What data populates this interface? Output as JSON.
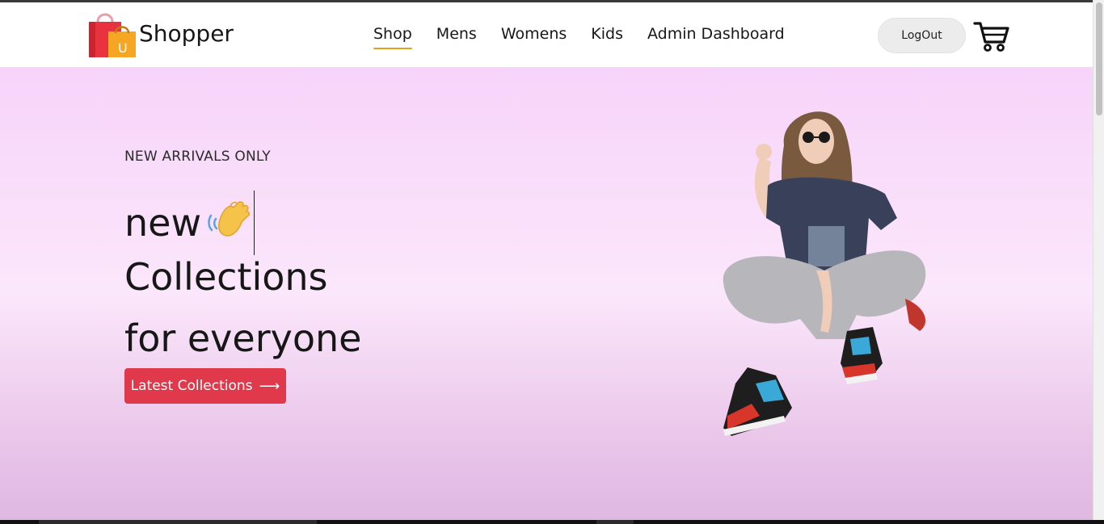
{
  "navbar": {
    "brand": "Shopper",
    "logo_letter": "U",
    "menu": [
      {
        "label": "Shop",
        "active": true
      },
      {
        "label": "Mens",
        "active": false
      },
      {
        "label": "Womens",
        "active": false
      },
      {
        "label": "Kids",
        "active": false
      },
      {
        "label": "Admin Dashboard",
        "active": false
      }
    ],
    "logout_label": "LogOut",
    "cart_icon": "shopping-cart-icon"
  },
  "hero": {
    "subtitle": "NEW ARRIVALS ONLY",
    "line1": "new",
    "line2": "Collections",
    "line3": "for everyone",
    "hand_icon": "waving-hand-icon",
    "button_label": "Latest Collections",
    "button_icon": "arrow-right-icon",
    "image": "hero-model-image"
  },
  "colors": {
    "accent": "#e0394b",
    "active_underline": "#e0a21b",
    "hero_top": "#f7d3fa",
    "hero_bottom": "#dfb8e2",
    "text": "#171717"
  }
}
